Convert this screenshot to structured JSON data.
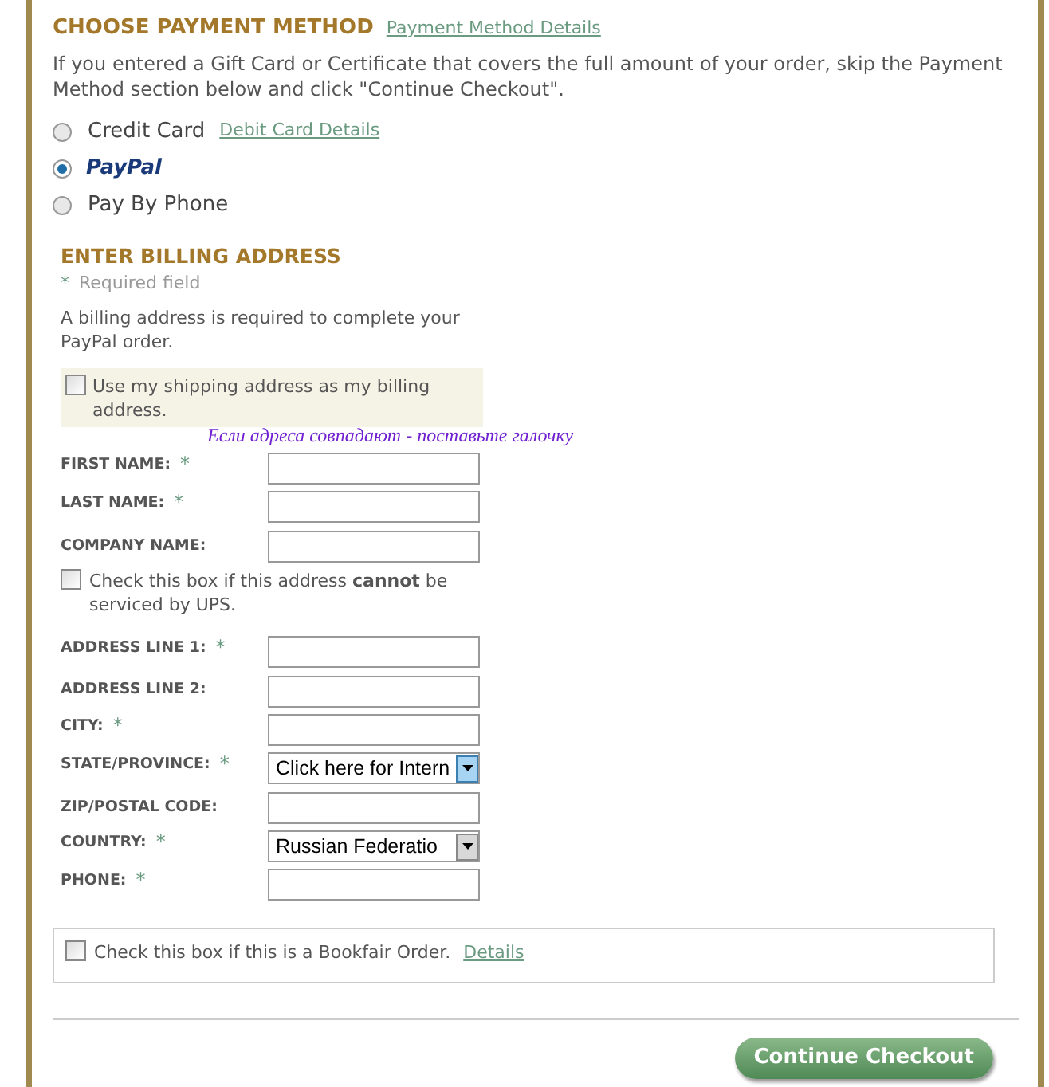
{
  "payment": {
    "title": "CHOOSE PAYMENT METHOD",
    "details_link": "Payment Method Details",
    "note": "If you entered a Gift Card or Certificate that covers the full amount of your order, skip the Payment Method section below and click \"Continue Checkout\".",
    "options": [
      {
        "kind": "text",
        "label": "Credit Card",
        "link": "Debit Card Details",
        "selected": false
      },
      {
        "kind": "logo",
        "label": "PayPal",
        "selected": true
      },
      {
        "kind": "text",
        "label": "Pay By Phone",
        "selected": false
      }
    ]
  },
  "billing": {
    "title": "ENTER BILLING ADDRESS",
    "required_mark": "*",
    "required_note": "Required field",
    "note": "A billing address is required to complete your PayPal order.",
    "same_address": {
      "label": "Use my shipping address as my billing address.",
      "checked": false,
      "hint": "Если адреса совпадают - поставьте галочку"
    },
    "fields": [
      {
        "kind": "input",
        "label": "FIRST NAME:",
        "required": true
      },
      {
        "kind": "input",
        "label": "LAST NAME:",
        "required": true
      },
      {
        "kind": "input",
        "label": "COMPANY NAME:",
        "required": false
      },
      {
        "kind": "checkbox",
        "label": "Check this box if this address **cannot** be serviced by UPS.",
        "checked": false
      },
      {
        "kind": "input",
        "label": "ADDRESS LINE 1:",
        "required": true
      },
      {
        "kind": "input",
        "label": "ADDRESS LINE 2:",
        "required": false
      },
      {
        "kind": "input",
        "label": "CITY:",
        "required": true
      },
      {
        "kind": "select",
        "label": "STATE/PROVINCE:",
        "required": true,
        "value": "Click here for Intern",
        "focused": true
      },
      {
        "kind": "input",
        "label": "ZIP/POSTAL CODE:",
        "required": false
      },
      {
        "kind": "select",
        "label": "COUNTRY:",
        "required": true,
        "value": "Russian Federatio",
        "focused": false
      },
      {
        "kind": "input",
        "label": "PHONE:",
        "required": true
      }
    ]
  },
  "bookfair": {
    "label": "Check this box if this is a Bookfair Order.",
    "link": "Details",
    "checked": false
  },
  "continue_button": "Continue Checkout"
}
